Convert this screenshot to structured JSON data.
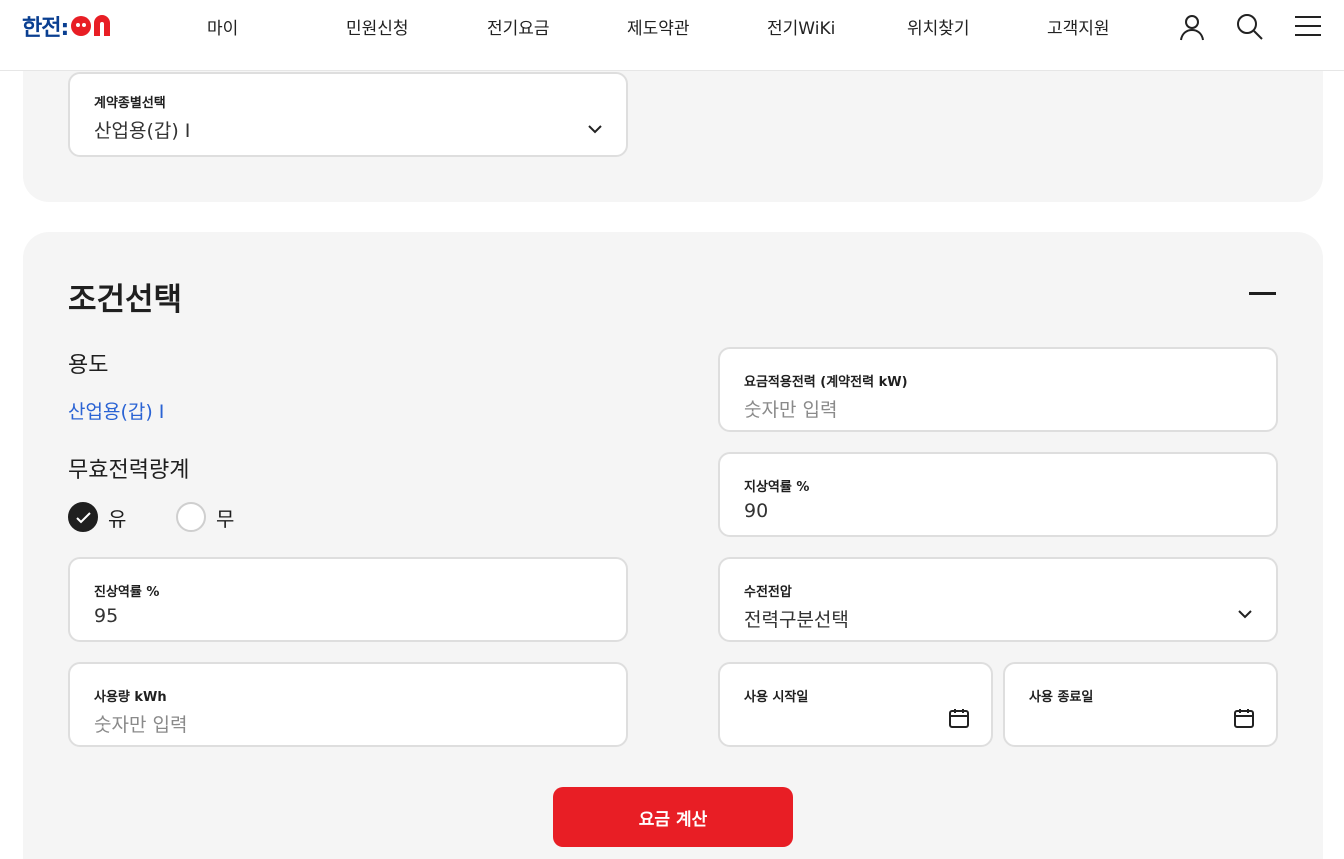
{
  "header": {
    "logo_text": "한전:",
    "nav": [
      "마이",
      "민원신청",
      "전기요금",
      "제도약관",
      "전기WiKi",
      "위치찾기",
      "고객지원"
    ],
    "icons": [
      "user-icon",
      "search-icon",
      "menu-icon"
    ]
  },
  "contract_select": {
    "label": "계약종별선택",
    "value": "산업용(갑) I"
  },
  "conditions": {
    "title": "조건선택",
    "usage_label": "용도",
    "usage_value": "산업용(갑) I",
    "reactive_label": "무효전력량계",
    "reactive_options": [
      {
        "label": "유",
        "checked": true
      },
      {
        "label": "무",
        "checked": false
      }
    ],
    "lagging_pf": {
      "label": "진상역률 %",
      "value": "95"
    },
    "usage_kwh": {
      "label": "사용량 kWh",
      "placeholder": "숫자만 입력"
    },
    "applied_power": {
      "label": "요금적용전력 (계약전력 kW)",
      "placeholder": "숫자만 입력"
    },
    "leading_pf": {
      "label": "지상역률 %",
      "value": "90"
    },
    "voltage": {
      "label": "수전전압",
      "value": "전력구분선택"
    },
    "start_date": {
      "label": "사용 시작일"
    },
    "end_date": {
      "label": "사용 종료일"
    },
    "calc_button": "요금 계산"
  },
  "colors": {
    "brand_blue": "#0a3f91",
    "brand_red": "#e81e25",
    "link_blue": "#2a63d4"
  }
}
